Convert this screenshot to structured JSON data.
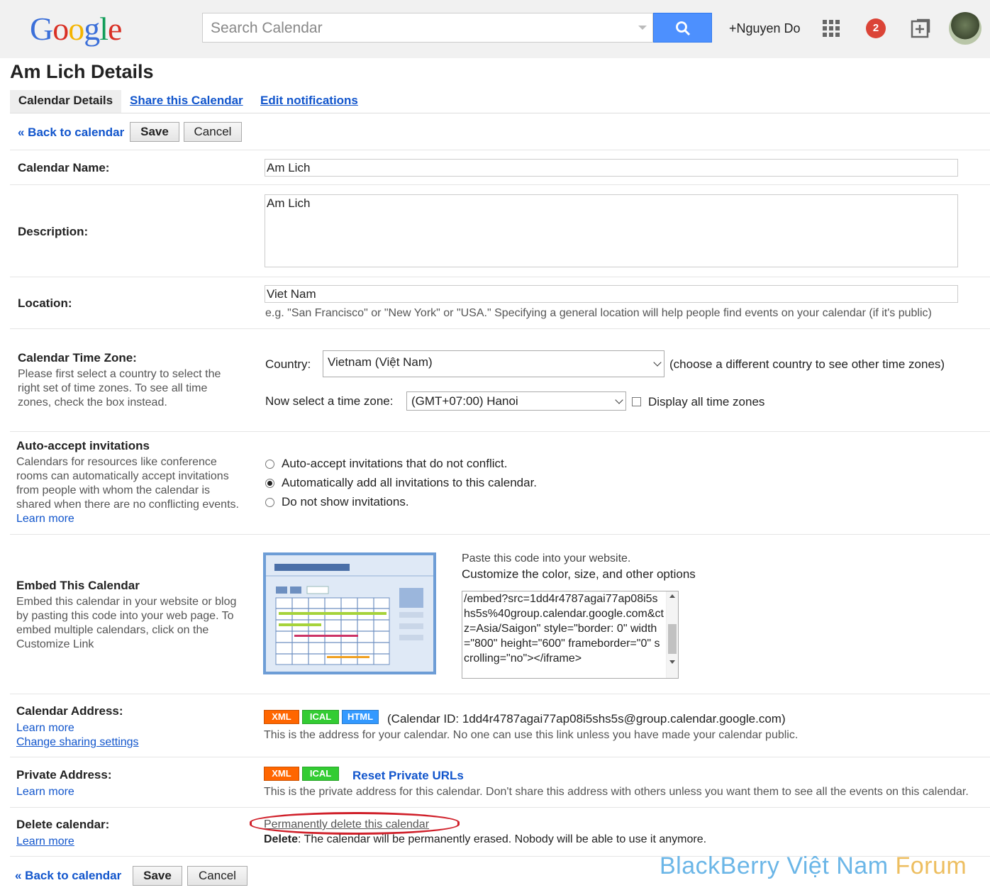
{
  "header": {
    "logo_letters": [
      "G",
      "o",
      "o",
      "g",
      "l",
      "e"
    ],
    "search_placeholder": "Search Calendar",
    "user_name": "+Nguyen Do",
    "notification_count": "2"
  },
  "page": {
    "title": "Am Lich Details",
    "tabs": [
      "Calendar Details",
      "Share this Calendar",
      "Edit notifications"
    ]
  },
  "actions": {
    "back": "« Back to calendar",
    "save": "Save",
    "cancel": "Cancel"
  },
  "name": {
    "label": "Calendar Name:",
    "value": "Am Lich"
  },
  "description": {
    "label": "Description:",
    "value": "Am Lich"
  },
  "location": {
    "label": "Location:",
    "value": "Viet Nam",
    "hint": "e.g. \"San Francisco\" or \"New York\" or \"USA.\" Specifying a general location will help people find events on your calendar (if it's public)"
  },
  "timezone": {
    "label": "Calendar Time Zone:",
    "help": "Please first select a country to select the right set of time zones. To see all time zones, check the box instead.",
    "country_label": "Country:",
    "country_value": "Vietnam (Việt Nam)",
    "country_hint": "(choose a different country to see other time zones)",
    "tz_label": "Now select a time zone:",
    "tz_value": "(GMT+07:00) Hanoi",
    "display_all": "Display all time zones"
  },
  "auto_accept": {
    "label": "Auto-accept invitations",
    "help": "Calendars for resources like conference rooms can automatically accept invitations from people with whom the calendar is shared when there are no conflicting events.",
    "learn_more": "Learn more",
    "options": [
      "Auto-accept invitations that do not conflict.",
      "Automatically add all invitations to this calendar.",
      "Do not show invitations."
    ],
    "selected_index": 1
  },
  "embed": {
    "label": "Embed This Calendar",
    "help": "Embed this calendar in your website or blog by pasting this code into your web page. To embed multiple calendars, click on the Customize Link",
    "paste_text": "Paste this code into your website.",
    "customize_link": "Customize the color, size, and other options",
    "code": "/embed?src=1dd4r4787agai77ap08i5shs5s%40group.calendar.google.com&ctz=Asia/Saigon\" style=\"border: 0\" width=\"800\" height=\"600\" frameborder=\"0\" scrolling=\"no\"></iframe>"
  },
  "address": {
    "label": "Calendar Address:",
    "learn_more": "Learn more",
    "change_sharing": "Change sharing settings",
    "badges": [
      "XML",
      "ICAL",
      "HTML"
    ],
    "calendar_id": "(Calendar ID: 1dd4r4787agai77ap08i5shs5s@group.calendar.google.com)",
    "note": "This is the address for your calendar. No one can use this link unless you have made your calendar public."
  },
  "private": {
    "label": "Private Address:",
    "learn_more": "Learn more",
    "badges": [
      "XML",
      "ICAL"
    ],
    "reset": "Reset Private URLs",
    "note": "This is the private address for this calendar. Don't share this address with others unless you want them to see all the events on this calendar."
  },
  "delete": {
    "label": "Delete calendar:",
    "learn_more": "Learn more",
    "link": "Permanently delete this calendar",
    "strong": "Delete",
    "note": ": The calendar will be permanently erased. Nobody will be able to use it anymore."
  },
  "watermark": {
    "main": "BlackBerry Việt Nam ",
    "accent": "Forum"
  },
  "colors": {
    "link": "#1155cc",
    "search_button": "#4d90fe",
    "highlight": "#d0202a",
    "notif": "#db4437"
  }
}
